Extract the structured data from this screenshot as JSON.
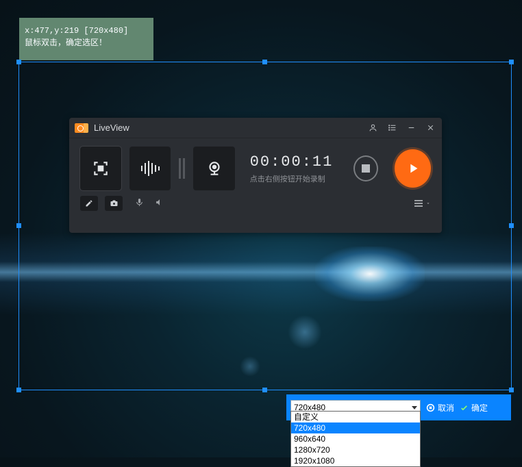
{
  "tooltip": {
    "coords": "x:477,y:219 [720x480]",
    "hint": "鼠标双击，确定选区！"
  },
  "liveview": {
    "title": "LiveView",
    "timer": "00:00:11",
    "timer_hint": "点击右侧按钮开始录制"
  },
  "bottom_bar": {
    "selected_resolution": "720x480",
    "cancel_label": "取消",
    "ok_label": "确定"
  },
  "resolution_options": [
    "自定义",
    "720x480",
    "960x640",
    "1280x720",
    "1920x1080"
  ],
  "resolution_selected_index": 1
}
